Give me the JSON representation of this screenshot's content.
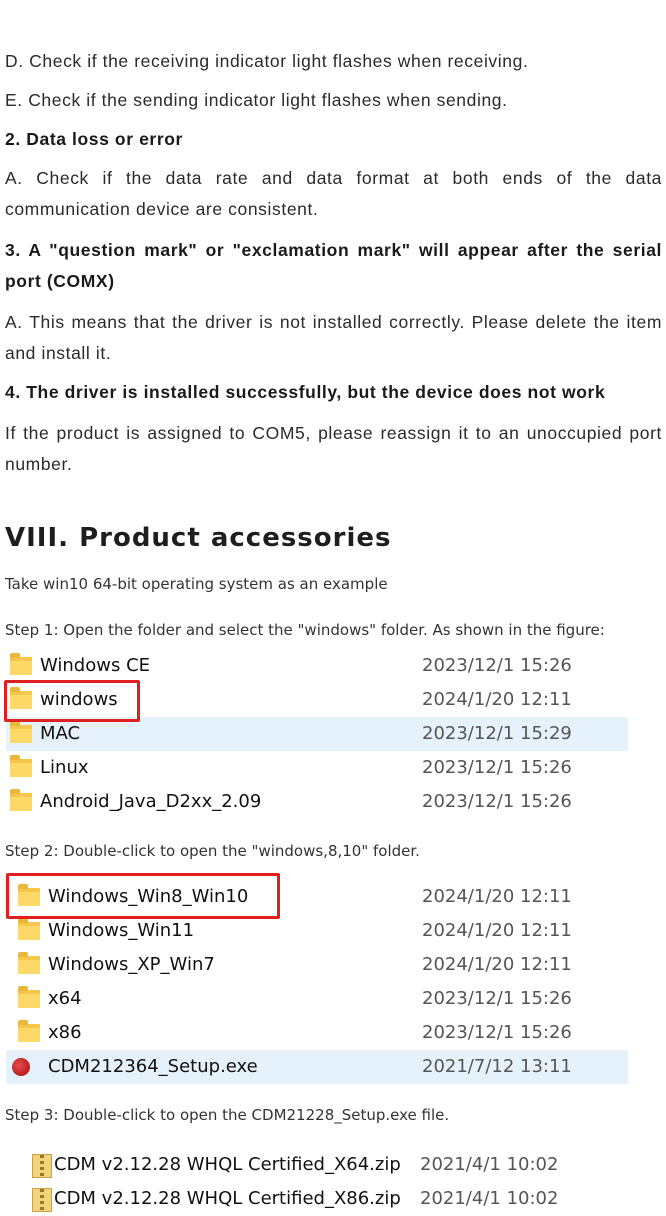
{
  "troubleshooting": {
    "item_d": "D. Check if the receiving indicator light flashes when receiving.",
    "item_e": "E. Check if the sending indicator light flashes when sending.",
    "heading_2": "2. Data loss or error",
    "text_2": "A. Check if the data rate and data format at both ends of the data communication device are consistent.",
    "heading_3": "3. A \"question mark\" or \"exclamation mark\" will appear after the serial port (COMX)",
    "text_3": "A. This means that the driver is not installed correctly. Please delete the item and install it.",
    "heading_4": "4. The driver is installed successfully, but the device does not work",
    "text_4": "If the product is assigned to COM5, please reassign it to an unoccupied port number."
  },
  "section": {
    "title": "VIII. Product accessories",
    "intro": "Take win10  64-bit operating system as an example",
    "step1": "Step 1: Open the folder and select the \"windows\" folder. As shown in the figure:",
    "step2": "Step 2: Double-click to open the \"windows,8,10\" folder.",
    "step3": "Step 3: Double-click to open the CDM21228_Setup.exe file."
  },
  "listing1": [
    {
      "name": "Windows CE",
      "date": "2023/12/1 15:26",
      "icon": "folder-icon"
    },
    {
      "name": "windows",
      "date": "2024/1/20 12:11",
      "icon": "folder-icon",
      "highlighted": true
    },
    {
      "name": "MAC",
      "date": "2023/12/1 15:29",
      "icon": "folder-icon",
      "selected": true
    },
    {
      "name": "Linux",
      "date": "2023/12/1 15:26",
      "icon": "folder-icon"
    },
    {
      "name": "Android_Java_D2xx_2.09",
      "date": "2023/12/1 15:26",
      "icon": "folder-icon"
    }
  ],
  "listing2": [
    {
      "name": "Windows_Win8_Win10",
      "date": "2024/1/20 12:11",
      "icon": "folder-icon",
      "highlighted": true
    },
    {
      "name": "Windows_Win11",
      "date": "2024/1/20 12:11",
      "icon": "folder-icon"
    },
    {
      "name": "Windows_XP_Win7",
      "date": "2024/1/20 12:11",
      "icon": "folder-icon"
    },
    {
      "name": "x64",
      "date": "2023/12/1 15:26",
      "icon": "folder-icon"
    },
    {
      "name": "x86",
      "date": "2023/12/1 15:26",
      "icon": "folder-icon"
    },
    {
      "name": "CDM212364_Setup.exe",
      "date": "2021/7/12 13:11",
      "icon": "setup-exe-icon",
      "selected": true
    }
  ],
  "listing3": [
    {
      "name": "CDM v2.12.28 WHQL Certified_X64.zip",
      "date": "2021/4/1 10:02",
      "icon": "zip-icon"
    },
    {
      "name": "CDM v2.12.28 WHQL Certified_X86.zip",
      "date": "2021/4/1 10:02",
      "icon": "zip-icon"
    }
  ],
  "colors": {
    "highlight_box": "#e02020",
    "selection": "#e5f1fb",
    "folder": "#ffd968"
  }
}
